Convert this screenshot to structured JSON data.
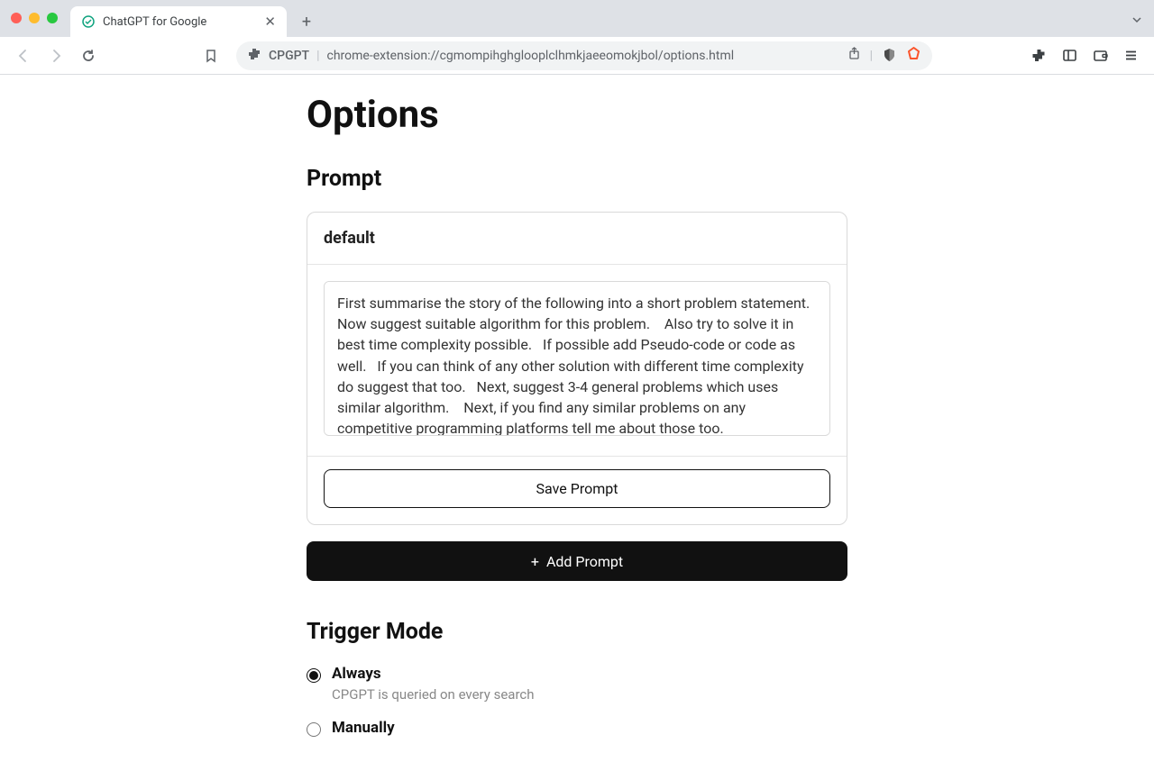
{
  "browser": {
    "tab_title": "ChatGPT for Google",
    "ext_label": "CPGPT",
    "url": "chrome-extension://cgmompihghglooplclhmkjaeeomokjbol/options.html"
  },
  "page": {
    "title": "Options",
    "prompt_section": "Prompt",
    "prompt_name": "default",
    "prompt_value": "First summarise the story of the following into a short problem statement.   Now suggest suitable algorithm for this problem.    Also try to solve it in best time complexity possible.   If possible add Pseudo-code or code as well.   If you can think of any other solution with different time complexity do suggest that too.   Next, suggest 3-4 general problems which uses similar algorithm.    Next, if you find any similar problems on any competitive programming platforms tell me about those too.  ",
    "save_label": "Save Prompt",
    "add_label": "Add Prompt",
    "trigger_section": "Trigger Mode",
    "trigger_options": [
      {
        "label": "Always",
        "desc": "CPGPT is queried on every search",
        "selected": true
      },
      {
        "label": "Manually",
        "desc": "",
        "selected": false
      }
    ]
  }
}
